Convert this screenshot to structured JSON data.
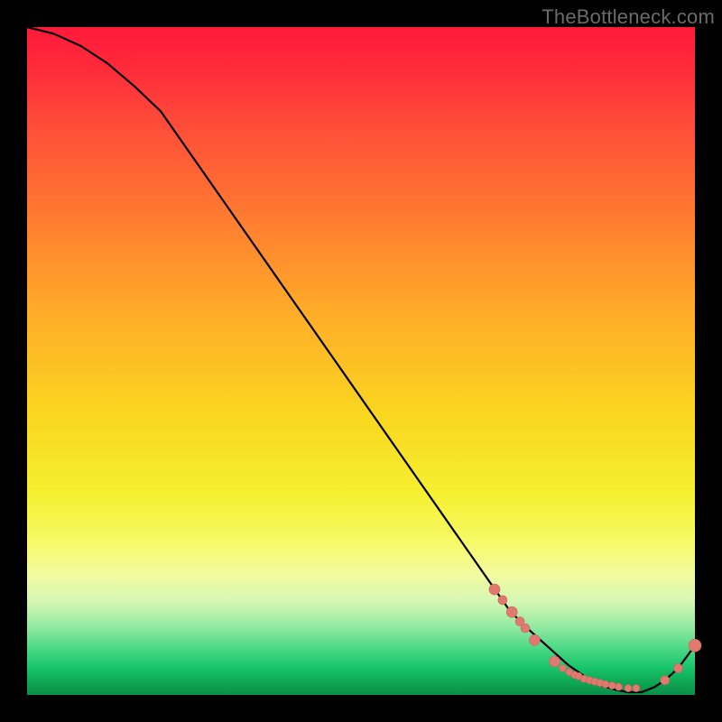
{
  "watermark": "TheBottleneck.com",
  "colors": {
    "marker": "#e07a70",
    "marker_stroke": "#c96459",
    "curve": "#000000"
  },
  "chart_data": {
    "type": "line",
    "title": "",
    "xlabel": "",
    "ylabel": "",
    "xlim": [
      0,
      1
    ],
    "ylim": [
      0,
      1
    ],
    "series": [
      {
        "name": "bottleneck-curve",
        "x": [
          0.0,
          0.04,
          0.08,
          0.12,
          0.16,
          0.2,
          0.72,
          0.74,
          0.76,
          0.78,
          0.8,
          0.81,
          0.84,
          0.86,
          0.88,
          0.9,
          0.92,
          0.94,
          0.955,
          0.975,
          1.0
        ],
        "y": [
          1.0,
          0.99,
          0.972,
          0.946,
          0.912,
          0.874,
          0.13,
          0.108,
          0.09,
          0.072,
          0.054,
          0.045,
          0.024,
          0.014,
          0.008,
          0.004,
          0.004,
          0.012,
          0.022,
          0.04,
          0.074
        ]
      }
    ],
    "markers": {
      "name": "highlighted-points",
      "series_label": "",
      "x": [
        0.7,
        0.712,
        0.726,
        0.738,
        0.746,
        0.76,
        0.79,
        0.802,
        0.812,
        0.82,
        0.826,
        0.834,
        0.842,
        0.85,
        0.858,
        0.866,
        0.876,
        0.886,
        0.9,
        0.912,
        0.955,
        0.975,
        1.0
      ],
      "y": [
        0.158,
        0.142,
        0.124,
        0.11,
        0.1,
        0.082,
        0.05,
        0.04,
        0.034,
        0.03,
        0.028,
        0.024,
        0.022,
        0.02,
        0.018,
        0.016,
        0.014,
        0.012,
        0.01,
        0.01,
        0.022,
        0.04,
        0.074
      ],
      "r": [
        6,
        5,
        6,
        5,
        5,
        6,
        6,
        4,
        4,
        4,
        4,
        4,
        4,
        4,
        4,
        4,
        4,
        4,
        4,
        4,
        5,
        5,
        7
      ]
    },
    "label_position": {
      "x": 0.845,
      "y": 0.018
    }
  }
}
